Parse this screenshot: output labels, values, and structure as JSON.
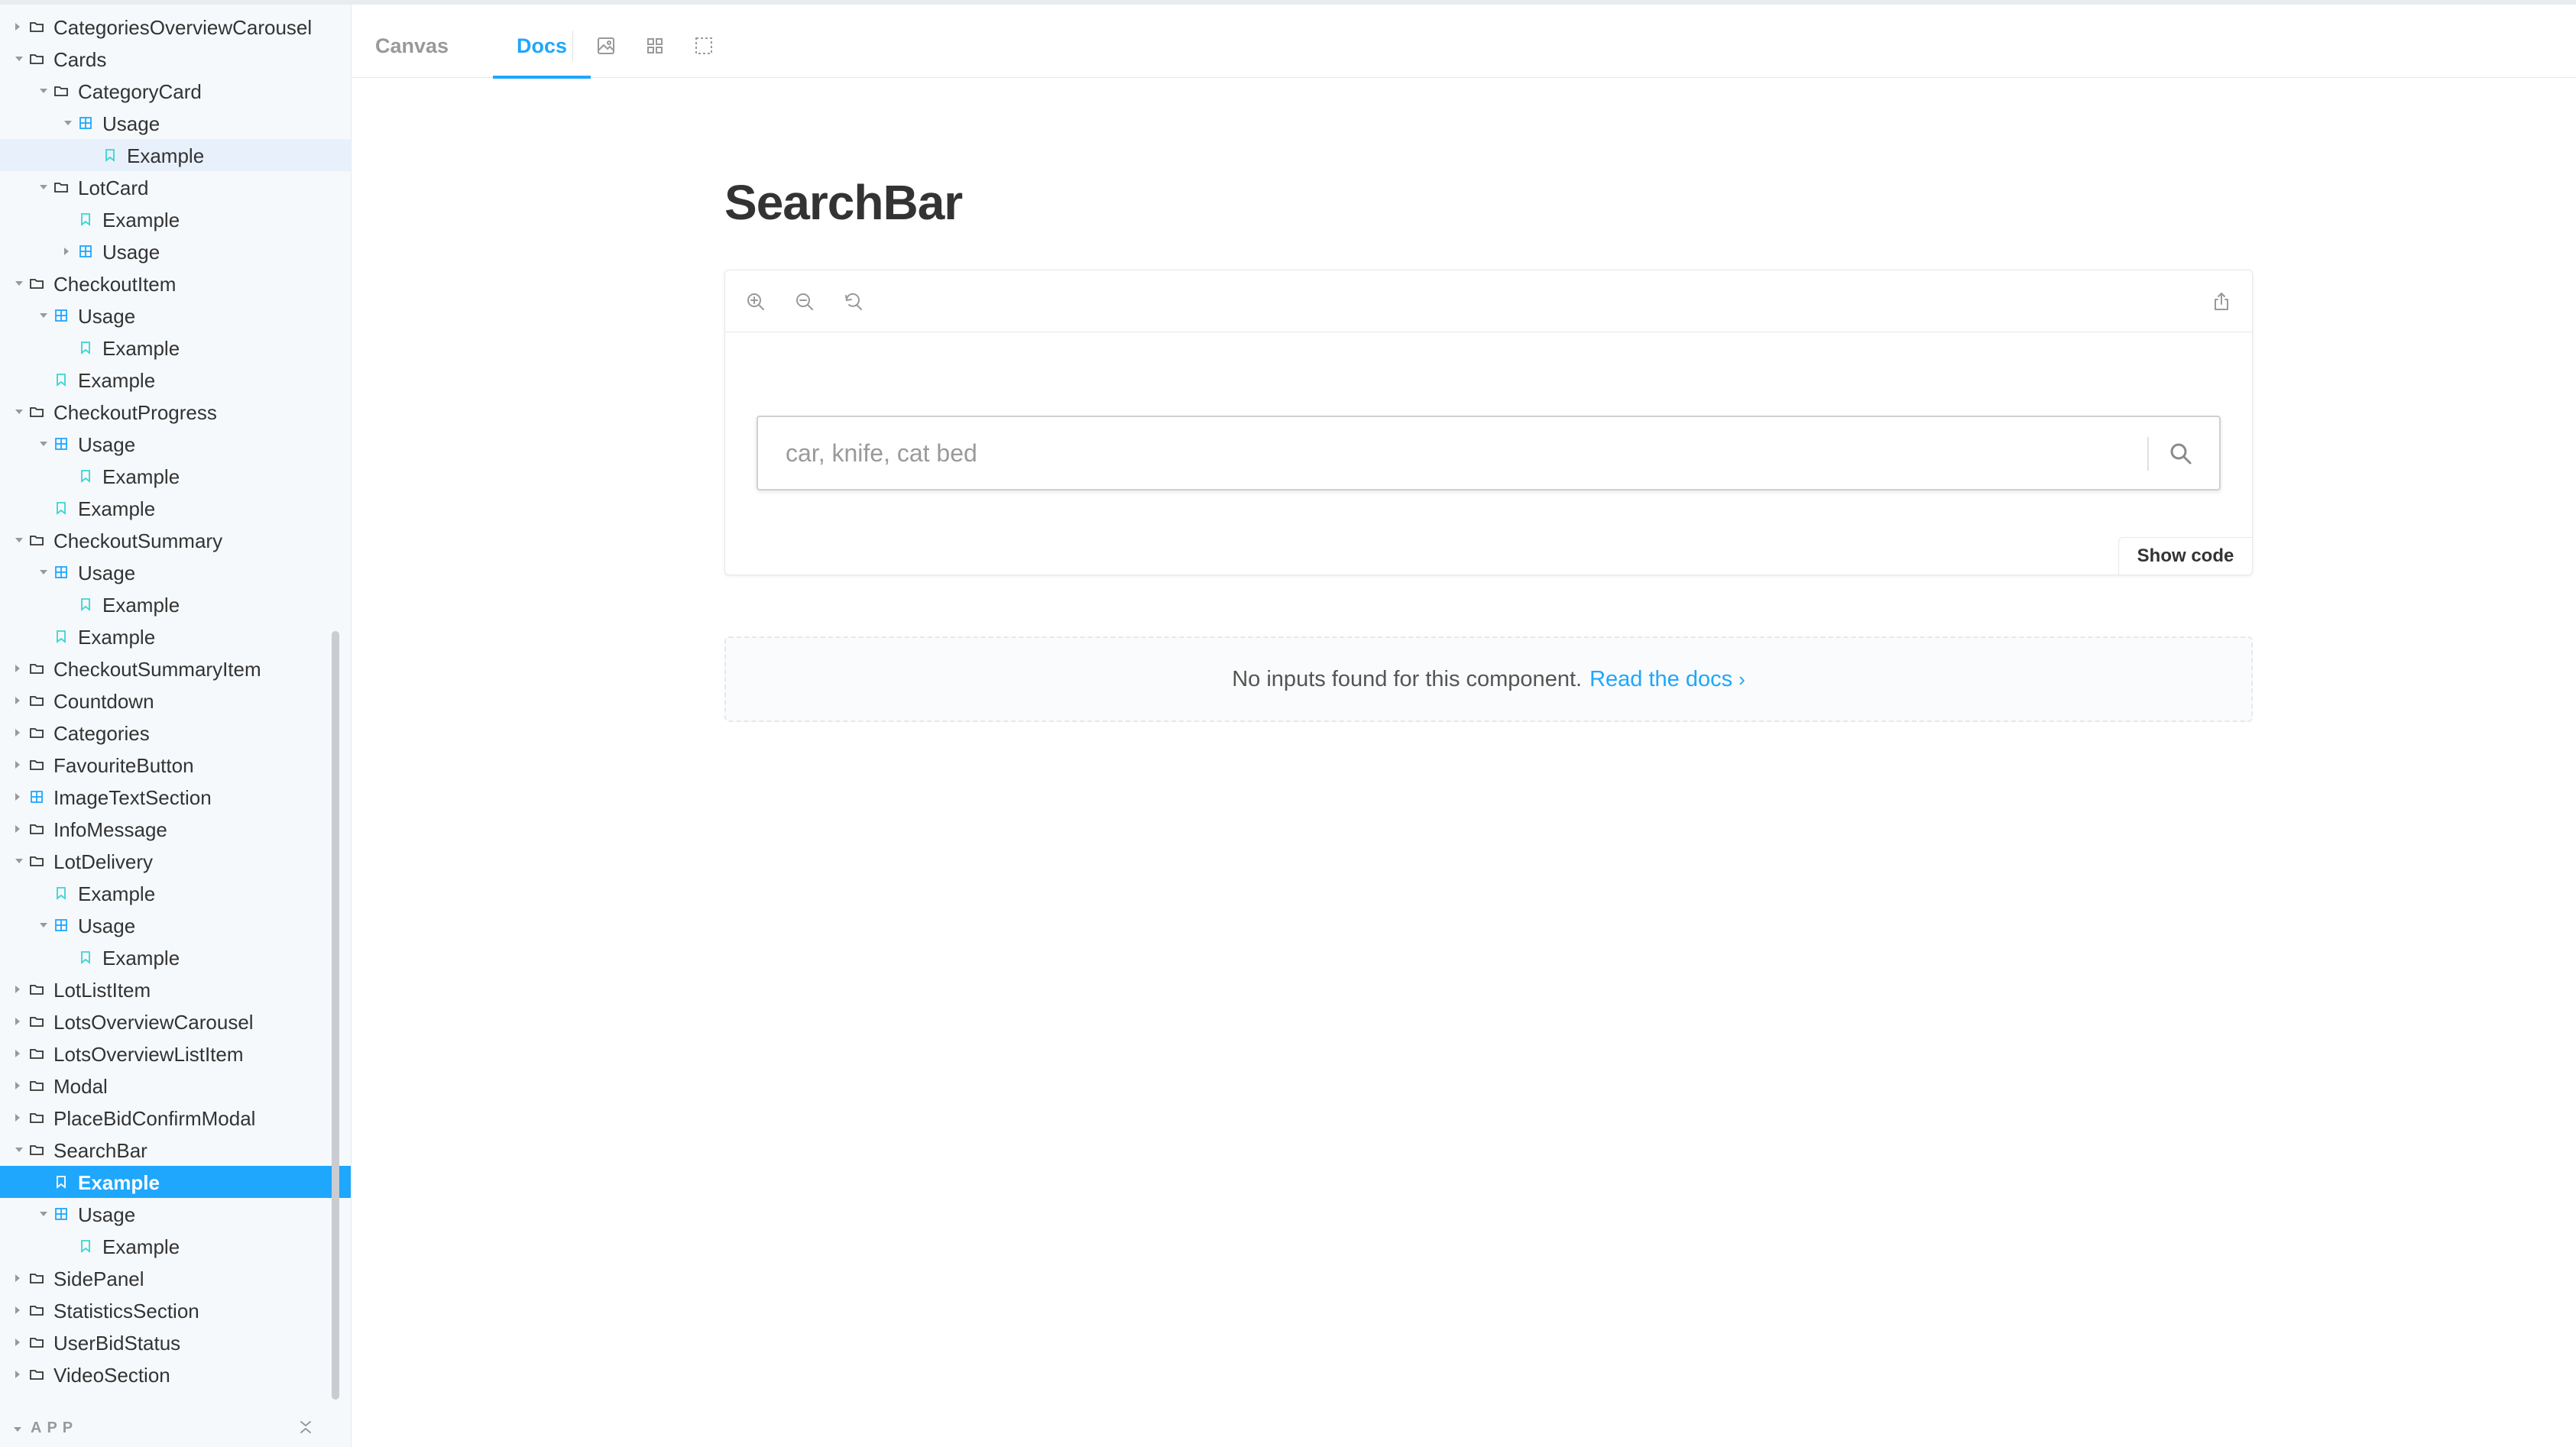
{
  "sidebar": {
    "tree": [
      {
        "label": "CategoriesOverviewCarousel",
        "level": 0,
        "type": "folder",
        "arrow": "right",
        "name": "tree-item-categoriesoverviewcarousel"
      },
      {
        "label": "Cards",
        "level": 0,
        "type": "folder",
        "arrow": "down",
        "name": "tree-item-cards"
      },
      {
        "label": "CategoryCard",
        "level": 1,
        "type": "folder",
        "arrow": "down",
        "name": "tree-item-categorycard"
      },
      {
        "label": "Usage",
        "level": 2,
        "type": "component",
        "arrow": "down",
        "name": "tree-item-usage"
      },
      {
        "label": "Example",
        "level": 3,
        "type": "story",
        "arrow": "",
        "state": "highlight",
        "name": "tree-item-example"
      },
      {
        "label": "LotCard",
        "level": 1,
        "type": "folder",
        "arrow": "down",
        "name": "tree-item-lotcard"
      },
      {
        "label": "Example",
        "level": 2,
        "type": "story",
        "arrow": "",
        "name": "tree-item-example"
      },
      {
        "label": "Usage",
        "level": 2,
        "type": "component",
        "arrow": "right",
        "name": "tree-item-usage"
      },
      {
        "label": "CheckoutItem",
        "level": 0,
        "type": "folder",
        "arrow": "down",
        "name": "tree-item-checkoutitem"
      },
      {
        "label": "Usage",
        "level": 1,
        "type": "component",
        "arrow": "down",
        "name": "tree-item-usage"
      },
      {
        "label": "Example",
        "level": 2,
        "type": "story",
        "arrow": "",
        "name": "tree-item-example"
      },
      {
        "label": "Example",
        "level": 1,
        "type": "story",
        "arrow": "",
        "name": "tree-item-example"
      },
      {
        "label": "CheckoutProgress",
        "level": 0,
        "type": "folder",
        "arrow": "down",
        "name": "tree-item-checkoutprogress"
      },
      {
        "label": "Usage",
        "level": 1,
        "type": "component",
        "arrow": "down",
        "name": "tree-item-usage"
      },
      {
        "label": "Example",
        "level": 2,
        "type": "story",
        "arrow": "",
        "name": "tree-item-example"
      },
      {
        "label": "Example",
        "level": 1,
        "type": "story",
        "arrow": "",
        "name": "tree-item-example"
      },
      {
        "label": "CheckoutSummary",
        "level": 0,
        "type": "folder",
        "arrow": "down",
        "name": "tree-item-checkoutsummary"
      },
      {
        "label": "Usage",
        "level": 1,
        "type": "component",
        "arrow": "down",
        "name": "tree-item-usage"
      },
      {
        "label": "Example",
        "level": 2,
        "type": "story",
        "arrow": "",
        "name": "tree-item-example"
      },
      {
        "label": "Example",
        "level": 1,
        "type": "story",
        "arrow": "",
        "name": "tree-item-example"
      },
      {
        "label": "CheckoutSummaryItem",
        "level": 0,
        "type": "folder",
        "arrow": "right",
        "name": "tree-item-checkoutsummaryitem"
      },
      {
        "label": "Countdown",
        "level": 0,
        "type": "folder",
        "arrow": "right",
        "name": "tree-item-countdown"
      },
      {
        "label": "Categories",
        "level": 0,
        "type": "folder",
        "arrow": "right",
        "name": "tree-item-categories"
      },
      {
        "label": "FavouriteButton",
        "level": 0,
        "type": "folder",
        "arrow": "right",
        "name": "tree-item-favouritebutton"
      },
      {
        "label": "ImageTextSection",
        "level": 0,
        "type": "component",
        "arrow": "right",
        "name": "tree-item-imagetextsection"
      },
      {
        "label": "InfoMessage",
        "level": 0,
        "type": "folder",
        "arrow": "right",
        "name": "tree-item-infomessage"
      },
      {
        "label": "LotDelivery",
        "level": 0,
        "type": "folder",
        "arrow": "down",
        "name": "tree-item-lotdelivery"
      },
      {
        "label": "Example",
        "level": 1,
        "type": "story",
        "arrow": "",
        "name": "tree-item-example"
      },
      {
        "label": "Usage",
        "level": 1,
        "type": "component",
        "arrow": "down",
        "name": "tree-item-usage"
      },
      {
        "label": "Example",
        "level": 2,
        "type": "story",
        "arrow": "",
        "name": "tree-item-example"
      },
      {
        "label": "LotListItem",
        "level": 0,
        "type": "folder",
        "arrow": "right",
        "name": "tree-item-lotlistitem"
      },
      {
        "label": "LotsOverviewCarousel",
        "level": 0,
        "type": "folder",
        "arrow": "right",
        "name": "tree-item-lotsoverviewcarousel"
      },
      {
        "label": "LotsOverviewListItem",
        "level": 0,
        "type": "folder",
        "arrow": "right",
        "name": "tree-item-lotsoverviewlistitem"
      },
      {
        "label": "Modal",
        "level": 0,
        "type": "folder",
        "arrow": "right",
        "name": "tree-item-modal"
      },
      {
        "label": "PlaceBidConfirmModal",
        "level": 0,
        "type": "folder",
        "arrow": "right",
        "name": "tree-item-placebidconfirmmodal"
      },
      {
        "label": "SearchBar",
        "level": 0,
        "type": "folder",
        "arrow": "down",
        "name": "tree-item-searchbar"
      },
      {
        "label": "Example",
        "level": 1,
        "type": "story",
        "arrow": "",
        "state": "active",
        "name": "tree-item-example"
      },
      {
        "label": "Usage",
        "level": 1,
        "type": "component",
        "arrow": "down",
        "name": "tree-item-usage"
      },
      {
        "label": "Example",
        "level": 2,
        "type": "story",
        "arrow": "",
        "name": "tree-item-example"
      },
      {
        "label": "SidePanel",
        "level": 0,
        "type": "folder",
        "arrow": "right",
        "name": "tree-item-sidepanel"
      },
      {
        "label": "StatisticsSection",
        "level": 0,
        "type": "folder",
        "arrow": "right",
        "name": "tree-item-statisticssection"
      },
      {
        "label": "UserBidStatus",
        "level": 0,
        "type": "folder",
        "arrow": "right",
        "name": "tree-item-userbidstatus"
      },
      {
        "label": "VideoSection",
        "level": 0,
        "type": "folder",
        "arrow": "right",
        "name": "tree-item-videosection"
      }
    ],
    "footer_label": "APP"
  },
  "toolbar": {
    "tab_canvas": "Canvas",
    "tab_docs": "Docs",
    "icons": [
      "image-background-icon",
      "grid-icon",
      "outline-icon"
    ]
  },
  "docs": {
    "title": "SearchBar",
    "preview_icons": [
      "zoom-in-icon",
      "zoom-out-icon",
      "zoom-reset-icon",
      "share-icon"
    ],
    "search_placeholder": "car, knife, cat bed",
    "search_value": "",
    "show_code_label": "Show code",
    "no_inputs_text": "No inputs found for this component.",
    "read_docs_label": "Read the docs",
    "read_docs_chevron": "›"
  },
  "colors": {
    "accent": "#1ea7fd",
    "sidebar_bg": "#f6f9fc",
    "folder_icon": "#333333",
    "component_icon": "#1ea7fd",
    "story_icon": "#37d5d3",
    "highlight_bg": "#e8f1fb"
  }
}
